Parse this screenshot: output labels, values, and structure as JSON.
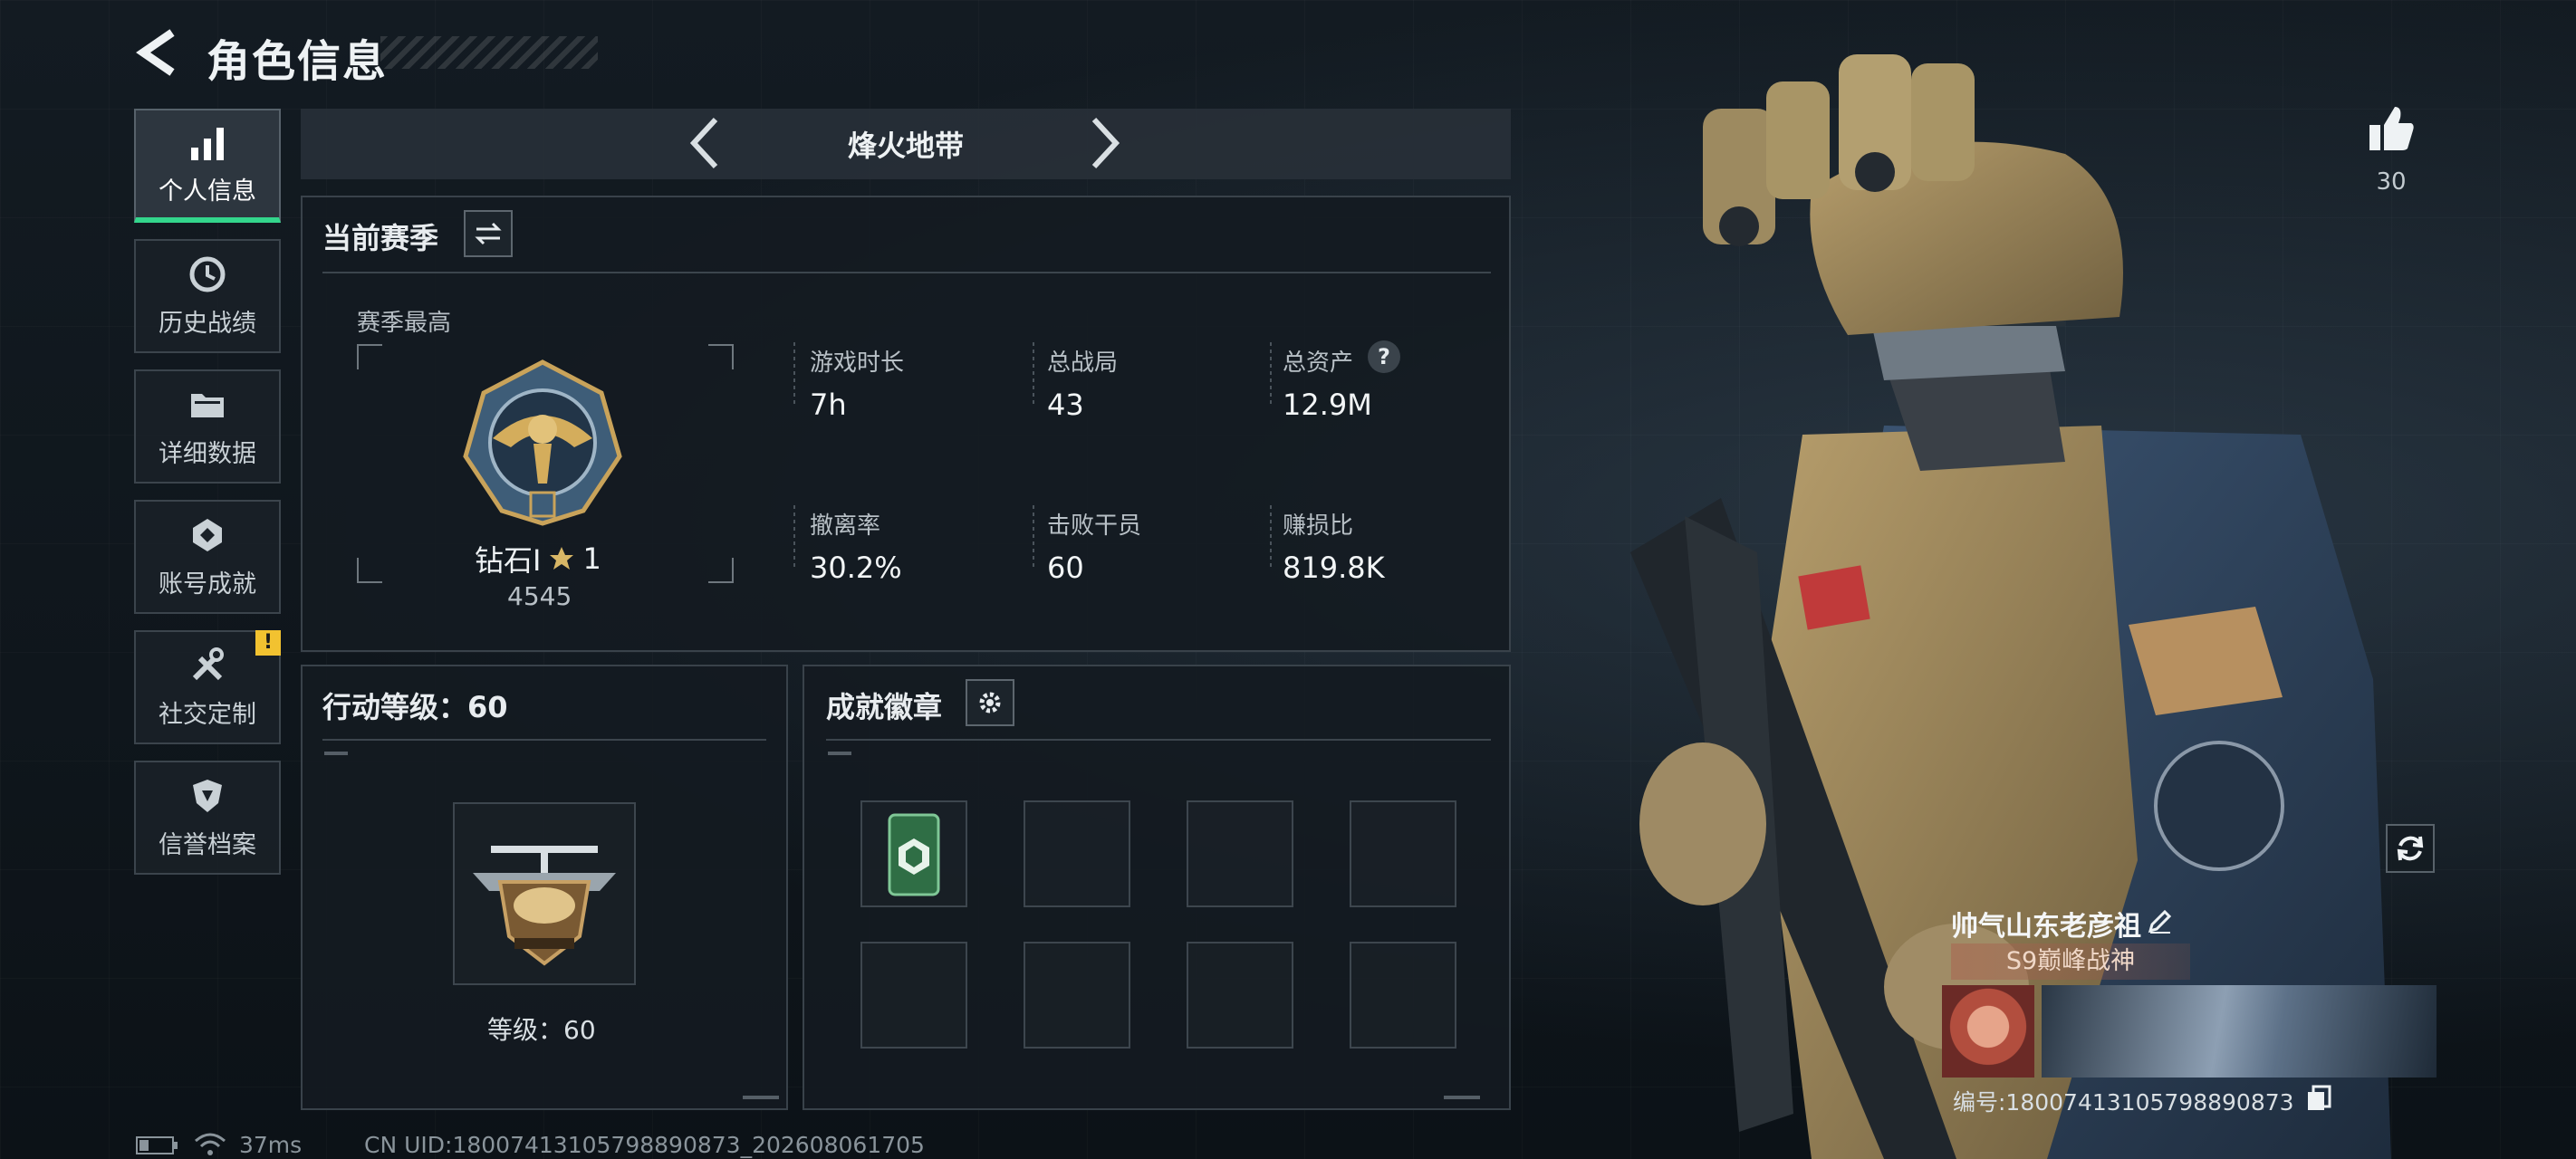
{
  "header": {
    "title": "角色信息"
  },
  "sidebar": {
    "items": [
      {
        "label": "个人信息",
        "icon": "bar-chart-icon",
        "active": true
      },
      {
        "label": "历史战绩",
        "icon": "history-clock-icon"
      },
      {
        "label": "详细数据",
        "icon": "folder-icon"
      },
      {
        "label": "账号成就",
        "icon": "achievement-badge-icon"
      },
      {
        "label": "社交定制",
        "icon": "tools-icon",
        "badge": "!"
      },
      {
        "label": "信誉档案",
        "icon": "shield-icon"
      }
    ]
  },
  "mode": {
    "name": "烽火地带"
  },
  "season": {
    "heading": "当前赛季",
    "best_label": "赛季最高",
    "rank_name": "钻石Ⅰ",
    "rank_stars": "1",
    "rank_points": "4545",
    "stats": [
      {
        "label": "游戏时长",
        "value": "7h"
      },
      {
        "label": "总战局",
        "value": "43"
      },
      {
        "label": "总资产",
        "value": "12.9M",
        "help": "?"
      },
      {
        "label": "撤离率",
        "value": "30.2%"
      },
      {
        "label": "击败干员",
        "value": "60"
      },
      {
        "label": "赚损比",
        "value": "819.8K"
      }
    ]
  },
  "action_level": {
    "heading": "行动等级：60",
    "level_text": "等级：60"
  },
  "achievement_badges": {
    "heading": "成就徽章",
    "slots": 8,
    "filled": 1
  },
  "profile": {
    "likes": "30",
    "player_name": "帅气山东老彦祖",
    "title": "S9巅峰战神",
    "uid_text": "编号:18007413105798890873"
  },
  "status_bar": {
    "ping": "37ms",
    "uid": "CN UID:18007413105798890873_202608061705"
  },
  "colors": {
    "accent": "#33d68c",
    "warning": "#f2c230",
    "panel_border": "#39424a"
  }
}
